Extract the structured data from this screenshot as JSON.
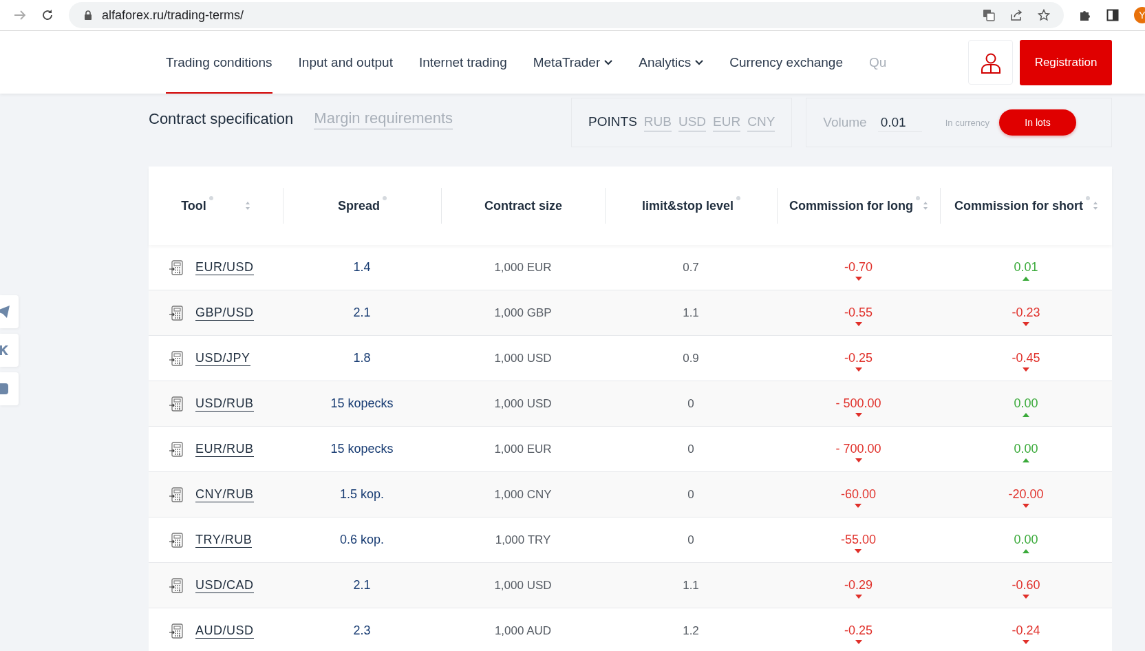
{
  "browser": {
    "url": "alfaforex.ru/trading-terms/",
    "profile_initial": "Y"
  },
  "nav": {
    "items": [
      {
        "label": "Trading conditions",
        "selected": true,
        "has_menu": false
      },
      {
        "label": "Input and output",
        "selected": false,
        "has_menu": false
      },
      {
        "label": "Internet trading",
        "selected": false,
        "has_menu": false
      },
      {
        "label": "MetaTrader",
        "selected": false,
        "has_menu": true
      },
      {
        "label": "Analytics",
        "selected": false,
        "has_menu": true
      },
      {
        "label": "Currency exchange",
        "selected": false,
        "has_menu": false
      },
      {
        "label": "Qu",
        "selected": false,
        "has_menu": false
      }
    ],
    "register_button": "Registration"
  },
  "tabs": [
    {
      "label": "Contract specification",
      "selected": true
    },
    {
      "label": "Margin requirements",
      "selected": false
    }
  ],
  "units": [
    {
      "label": "POINTS",
      "selected": true
    },
    {
      "label": "RUB",
      "selected": false
    },
    {
      "label": "USD",
      "selected": false
    },
    {
      "label": "EUR",
      "selected": false
    },
    {
      "label": "CNY",
      "selected": false
    }
  ],
  "volume": {
    "label": "Volume",
    "value": "0.01",
    "modes": [
      {
        "label": "In currency",
        "selected": false
      },
      {
        "label": "In lots",
        "selected": true
      }
    ]
  },
  "table": {
    "columns": [
      {
        "label": "Tool",
        "info": true,
        "sortable": true
      },
      {
        "label": "Spread",
        "info": true,
        "sortable": false
      },
      {
        "label": "Contract size",
        "info": false,
        "sortable": false
      },
      {
        "label": "limit&stop level",
        "info": true,
        "sortable": false
      },
      {
        "label": "Commission for long",
        "info": true,
        "sortable": true
      },
      {
        "label": "Commission for short",
        "info": true,
        "sortable": true
      }
    ],
    "rows": [
      {
        "tool": "EUR/USD",
        "spread": "1.4",
        "contract_size": "1,000 EUR",
        "level": "0.7",
        "long": {
          "value": "-0.70",
          "rising": false
        },
        "short": {
          "value": "0.01",
          "rising": true
        }
      },
      {
        "tool": "GBP/USD",
        "spread": "2.1",
        "contract_size": "1,000 GBP",
        "level": "1.1",
        "long": {
          "value": "-0.55",
          "rising": false
        },
        "short": {
          "value": "-0.23",
          "rising": false
        }
      },
      {
        "tool": "USD/JPY",
        "spread": "1.8",
        "contract_size": "1,000 USD",
        "level": "0.9",
        "long": {
          "value": "-0.25",
          "rising": false
        },
        "short": {
          "value": "-0.45",
          "rising": false
        }
      },
      {
        "tool": "USD/RUB",
        "spread": "15 kopecks",
        "contract_size": "1,000 USD",
        "level": "0",
        "long": {
          "value": "- 500.00",
          "rising": false
        },
        "short": {
          "value": "0.00",
          "rising": true
        }
      },
      {
        "tool": "EUR/RUB",
        "spread": "15 kopecks",
        "contract_size": "1,000 EUR",
        "level": "0",
        "long": {
          "value": "- 700.00",
          "rising": false
        },
        "short": {
          "value": "0.00",
          "rising": true
        }
      },
      {
        "tool": "CNY/RUB",
        "spread": "1.5 kop.",
        "contract_size": "1,000 CNY",
        "level": "0",
        "long": {
          "value": "-60.00",
          "rising": false
        },
        "short": {
          "value": "-20.00",
          "rising": false
        }
      },
      {
        "tool": "TRY/RUB",
        "spread": "0.6 kop.",
        "contract_size": "1,000 TRY",
        "level": "0",
        "long": {
          "value": "-55.00",
          "rising": false
        },
        "short": {
          "value": "0.00",
          "rising": true
        }
      },
      {
        "tool": "USD/CAD",
        "spread": "2.1",
        "contract_size": "1,000 USD",
        "level": "1.1",
        "long": {
          "value": "-0.29",
          "rising": false
        },
        "short": {
          "value": "-0.60",
          "rising": false
        }
      },
      {
        "tool": "AUD/USD",
        "spread": "2.3",
        "contract_size": "1,000 AUD",
        "level": "1.2",
        "long": {
          "value": "-0.25",
          "rising": false
        },
        "short": {
          "value": "-0.24",
          "rising": false
        }
      }
    ]
  }
}
